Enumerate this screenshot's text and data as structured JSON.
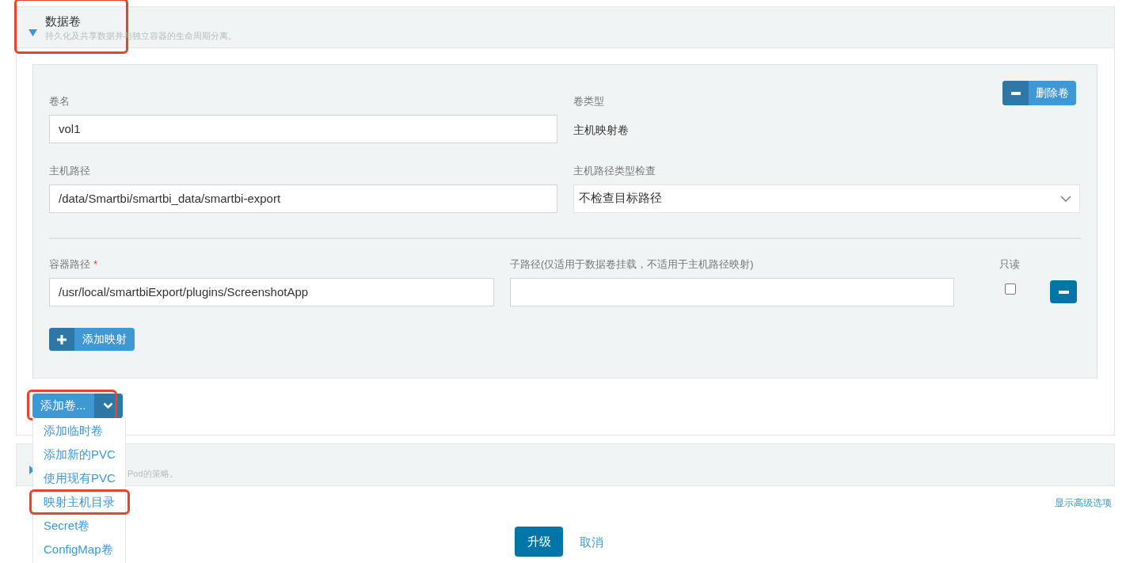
{
  "volumes_section": {
    "title": "数据卷",
    "description": "持久化及共享数据并与独立容器的生命周期分离。",
    "expanded": true,
    "highlighted": true,
    "volume": {
      "name_label": "卷名",
      "name_value": "vol1",
      "type_label": "卷类型",
      "type_value": "主机映射卷",
      "remove_button": "删除卷",
      "host_path_label": "主机路径",
      "host_path_value": "/data/Smartbi/smartbi_data/smartbi-export",
      "check_label": "主机路径类型检查",
      "check_value": "不检查目标路径",
      "mapping": {
        "container_path_label": "容器路径",
        "required_mark": "*",
        "container_path_value": "/usr/local/smartbiExport/plugins/ScreenshotApp",
        "sub_path_label": "子路径(仅适用于数据卷挂载，不适用于主机路径映射)",
        "read_only_label": "只读",
        "read_only": false
      },
      "add_mapping_button": "添加映射"
    },
    "add_volume": {
      "label": "添加卷...",
      "highlighted": true,
      "menu": [
        {
          "label": "添加临时卷",
          "highlighted": false
        },
        {
          "label": "添加新的PVC",
          "highlighted": false
        },
        {
          "label": "使用现有PVC",
          "highlighted": false
        },
        {
          "label": "映射主机目录",
          "highlighted": true
        },
        {
          "label": "Secret卷",
          "highlighted": false
        },
        {
          "label": "ConfigMap卷",
          "highlighted": false
        }
      ]
    }
  },
  "second_section": {
    "expanded": false,
    "description": "Pod的策略。"
  },
  "advanced_link": "显示高级选项",
  "buttons": {
    "upgrade": "升级",
    "cancel": "取消"
  }
}
